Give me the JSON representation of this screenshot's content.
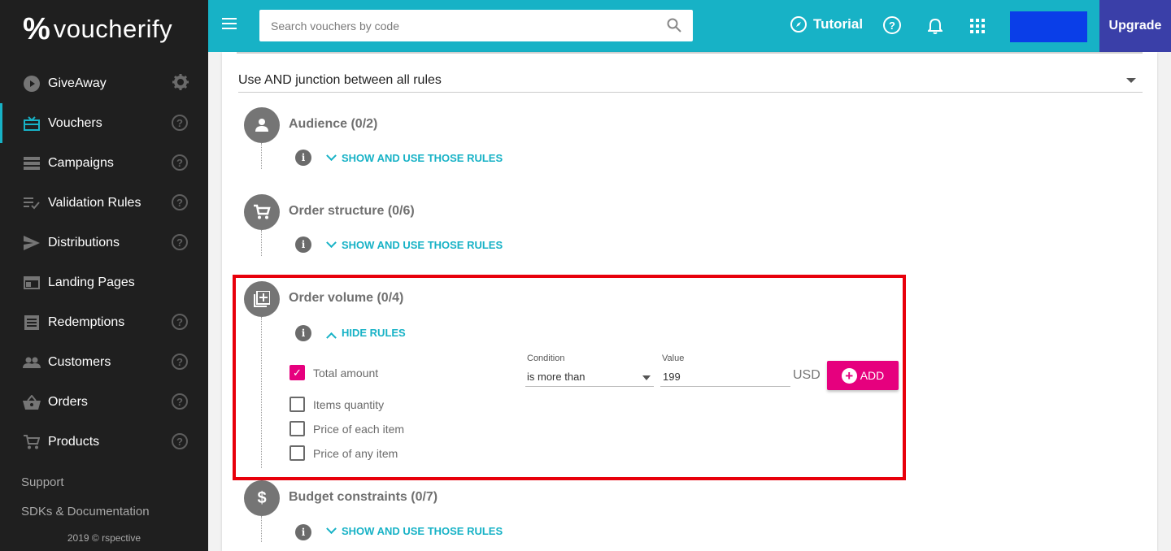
{
  "brand": {
    "mark": "%",
    "name": "voucherify"
  },
  "sidebar": {
    "items": [
      {
        "label": "GiveAway",
        "icon": "play-circle-icon",
        "trailing": "gear"
      },
      {
        "label": "Vouchers",
        "icon": "gift-icon",
        "trailing": "help",
        "active": true
      },
      {
        "label": "Campaigns",
        "icon": "list-icon",
        "trailing": "help"
      },
      {
        "label": "Validation Rules",
        "icon": "rules-icon",
        "trailing": "help"
      },
      {
        "label": "Distributions",
        "icon": "send-icon",
        "trailing": "help"
      },
      {
        "label": "Landing Pages",
        "icon": "web-icon",
        "trailing": "none"
      },
      {
        "label": "Redemptions",
        "icon": "document-icon",
        "trailing": "help"
      },
      {
        "label": "Customers",
        "icon": "people-icon",
        "trailing": "help"
      },
      {
        "label": "Orders",
        "icon": "basket-icon",
        "trailing": "help"
      },
      {
        "label": "Products",
        "icon": "cart-icon",
        "trailing": "help"
      }
    ],
    "help_glyph": "?",
    "links": [
      "Support",
      "SDKs & Documentation"
    ],
    "copyright": "2019 © rspective"
  },
  "topbar": {
    "search_placeholder": "Search vouchers by code",
    "tutorial_label": "Tutorial",
    "help_glyph": "?",
    "upgrade_label": "Upgrade",
    "accent_color": "#17b2c6",
    "upgrade_color": "#3a3fa8"
  },
  "rules": {
    "junction": "Use AND junction between all rules",
    "info_glyph": "i",
    "sections": {
      "audience": {
        "title": "Audience (0/2)",
        "toggle": "SHOW AND USE THOSE RULES"
      },
      "order_structure": {
        "title": "Order structure (0/6)",
        "toggle": "SHOW AND USE THOSE RULES"
      },
      "order_volume": {
        "title": "Order volume (0/4)",
        "toggle": "HIDE RULES",
        "options": [
          {
            "label": "Total amount",
            "checked": true
          },
          {
            "label": "Items quantity",
            "checked": false
          },
          {
            "label": "Price of each item",
            "checked": false
          },
          {
            "label": "Price of any item",
            "checked": false
          }
        ],
        "condition_label": "Condition",
        "condition_value": "is more than",
        "value_label": "Value",
        "value": "199",
        "currency": "USD",
        "add_label": "ADD"
      },
      "budget": {
        "title": "Budget constraints (0/7)",
        "toggle": "SHOW AND USE THOSE RULES",
        "icon_glyph": "$"
      }
    },
    "checkmark": "✓",
    "plus": "+",
    "highlight_color": "#e8000b",
    "primary_color": "#e6007e"
  }
}
